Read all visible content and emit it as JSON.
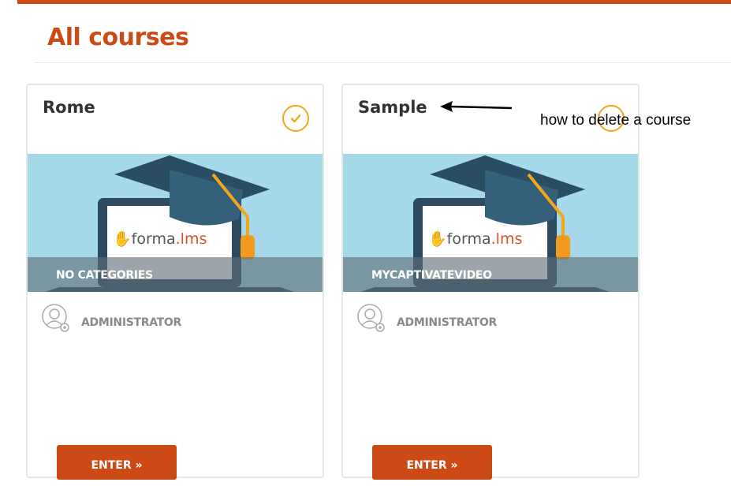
{
  "page": {
    "title": "All courses"
  },
  "courses": [
    {
      "name": "Rome",
      "status_icon": "check-circle-icon",
      "brand_mark": "✋",
      "brand_prefix": "forma",
      "brand_suffix": ".lms",
      "category": "NO CATEGORIES",
      "role": "ADMINISTRATOR",
      "enter_label": "ENTER »"
    },
    {
      "name": "Sample",
      "status_icon": "circle-icon",
      "brand_mark": "✋",
      "brand_prefix": "forma",
      "brand_suffix": ".lms",
      "category": "MYCAPTIVATEVIDEO",
      "role": "ADMINISTRATOR",
      "enter_label": "ENTER »"
    }
  ],
  "annotation": {
    "text": "how to delete a course"
  },
  "colors": {
    "accent": "#cc4a16",
    "status": "#f2a71b",
    "thumb_bg": "#a5d8e9"
  }
}
